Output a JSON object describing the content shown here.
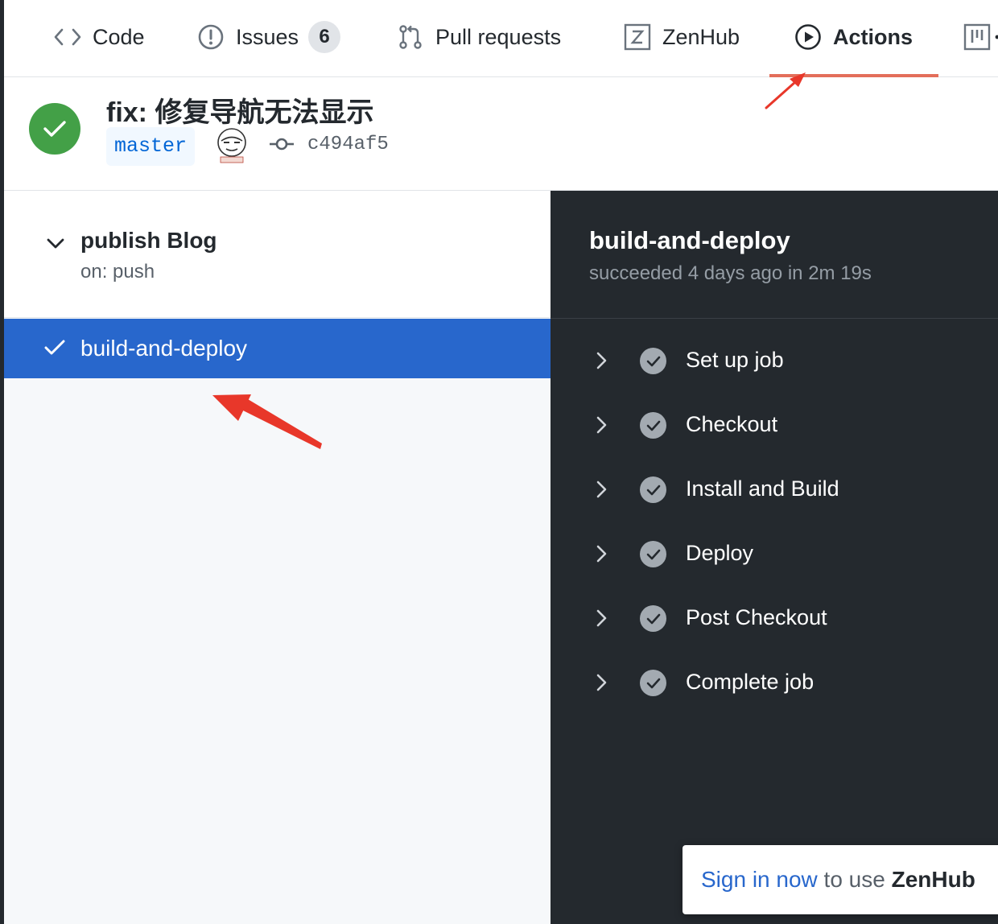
{
  "tabs": [
    {
      "label": "Code",
      "icon": "code-icon"
    },
    {
      "label": "Issues",
      "icon": "issue-icon",
      "count": "6"
    },
    {
      "label": "Pull requests",
      "icon": "pull-request-icon"
    },
    {
      "label": "ZenHub",
      "icon": "zenhub-icon"
    },
    {
      "label": "Actions",
      "icon": "play-icon",
      "active": true
    },
    {
      "label": "",
      "icon": "project-icon"
    }
  ],
  "commit": {
    "title": "fix: 修复导航无法显示",
    "branch": "master",
    "sha": "c494af5",
    "status": "success"
  },
  "workflow": {
    "name": "publish Blog",
    "trigger": "on: push",
    "jobs": [
      {
        "name": "build-and-deploy",
        "selected": true
      }
    ]
  },
  "job_detail": {
    "title": "build-and-deploy",
    "subtitle": "succeeded 4 days ago in 2m 19s",
    "steps": [
      {
        "label": "Set up job"
      },
      {
        "label": "Checkout"
      },
      {
        "label": "Install and Build"
      },
      {
        "label": "Deploy"
      },
      {
        "label": "Post Checkout"
      },
      {
        "label": "Complete job"
      }
    ]
  },
  "toast": {
    "link": "Sign in now",
    "middle": " to use ",
    "brand": "ZenHub"
  },
  "colors": {
    "success": "#43a047",
    "selected": "#2867cc",
    "dark_panel": "#24292e",
    "annotation": "#e8372a",
    "active_tab": "#e36e5a"
  }
}
